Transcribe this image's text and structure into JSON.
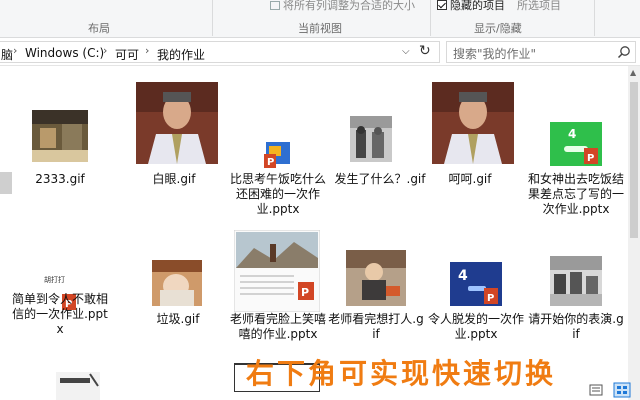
{
  "ribbon": {
    "partial_text": "将所有列调整为合适的大小",
    "hidden_items_label": "隐藏的项目",
    "hide_selected_label": "所选项目",
    "groups": {
      "layout": "布局",
      "current_view": "当前视图",
      "show_hide": "显示/隐藏"
    }
  },
  "address": {
    "crumbs": [
      "脑",
      "Windows (C:)",
      "可可",
      "我的作业"
    ]
  },
  "search": {
    "placeholder": "搜索\"我的作业\""
  },
  "files": [
    {
      "name": "2333.gif"
    },
    {
      "name": "白眼.gif"
    },
    {
      "name": "比思考午饭吃什么还困难的一次作业.pptx"
    },
    {
      "name": "发生了什么？.gif"
    },
    {
      "name": "呵呵.gif"
    },
    {
      "name": "和女神出去吃饭结果差点忘了写的一次作业.pptx"
    },
    {
      "name": "简单到令人不敢相信的一次作业.pptx"
    },
    {
      "name": "垃圾.gif"
    },
    {
      "name": "老师看完脸上笑嘻嘻的作业.pptx"
    },
    {
      "name": "老师看完想打人.gif"
    },
    {
      "name": "令人脱发的一次作业.pptx"
    },
    {
      "name": "请开始你的表演.gif"
    }
  ],
  "caption": "右下角可实现快速切换",
  "colors": {
    "ppt": "#d24625",
    "caption": "#f07c12",
    "accent": "#1e78d7"
  }
}
